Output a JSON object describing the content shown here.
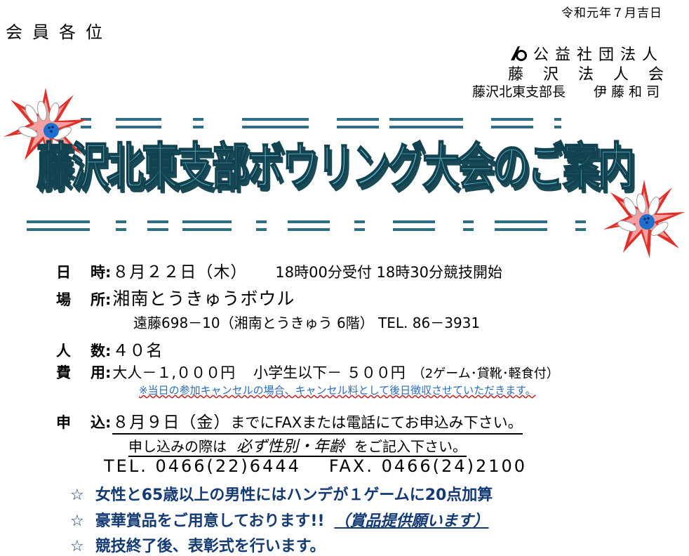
{
  "header": {
    "date": "令和元年７月吉日",
    "salutation": "会員各位",
    "org_type": "公益社団法人",
    "org_name": "藤沢法人会",
    "branch_head_title": "藤沢北東支部長",
    "branch_head_name": "伊藤和司"
  },
  "title": "藤沢北東支部ボウリング大会のご案内",
  "details": {
    "datetime_label_1": "日",
    "datetime_label_2": "時",
    "datetime_value": "８月２２日（木）",
    "datetime_extra": "18時00分受付 18時30分競技開始",
    "place_label_1": "場",
    "place_label_2": "所",
    "place_value": "湘南とうきゅうボウル",
    "place_address": "遠藤698－10（湘南とうきゅう 6階） TEL. 86－3931",
    "count_label_1": "人",
    "count_label_2": "数",
    "count_value": "４０名",
    "fee_label_1": "費",
    "fee_label_2": "用",
    "fee_adult": "大人－１,０００円",
    "fee_child": "小学生以下－ ５００円",
    "fee_note": "（2ゲーム･貸靴･軽食付）",
    "cancel_note": "※当日の参加キャンセルの場合、キャンセル料として後日徴収させていただきます。",
    "apply_label_1": "申",
    "apply_label_2": "込",
    "apply_date": "８月９日（金）",
    "apply_text": "までにFAXまたは電話にてお申込み下さい。",
    "apply_line2_a": "申し込みの際は",
    "apply_line2_b": "必ず性別・年齢",
    "apply_line2_c": "をご記入下さい。",
    "tel": "TEL. 0466(22)6444",
    "fax": "FAX. 0466(24)2100"
  },
  "bullets": [
    {
      "mark": "☆",
      "text": "女性と65歳以上の男性にはハンデが１ゲームに20点加算"
    },
    {
      "mark": "☆",
      "text": "豪華賞品をご用意しております!!",
      "extra": "（賞品提供願います）"
    },
    {
      "mark": "☆",
      "text": "競技終了後、表彰式を行います。"
    }
  ],
  "colors": {
    "title": "#5fb2c4",
    "title_outline": "#12424f",
    "bullet": "#143a73",
    "note": "#2a6db8",
    "burst_red": "#e0302a"
  },
  "icons": [
    "org-logo-icon",
    "bowling-burst-icon"
  ]
}
